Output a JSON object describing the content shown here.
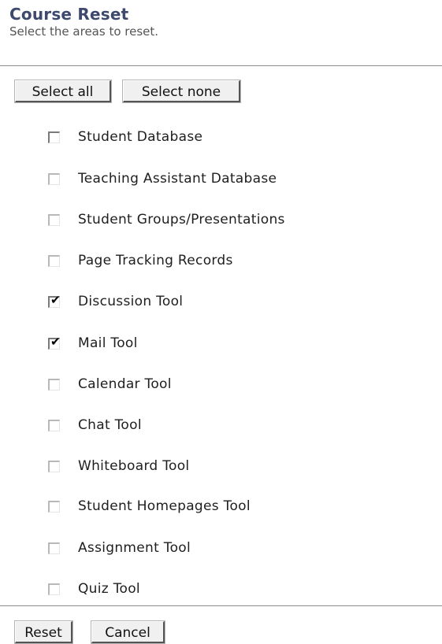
{
  "header": {
    "title": "Course Reset",
    "subtitle": "Select the areas to reset."
  },
  "toolbar": {
    "select_all_label": "Select all",
    "select_none_label": "Select none"
  },
  "options": [
    {
      "label": "Student Database",
      "checked": false
    },
    {
      "label": "Teaching Assistant Database",
      "checked": false
    },
    {
      "label": "Student Groups/Presentations",
      "checked": false
    },
    {
      "label": "Page Tracking Records",
      "checked": false
    },
    {
      "label": "Discussion Tool",
      "checked": true
    },
    {
      "label": "Mail Tool",
      "checked": true
    },
    {
      "label": "Calendar Tool",
      "checked": false
    },
    {
      "label": "Chat Tool",
      "checked": false
    },
    {
      "label": "Whiteboard Tool",
      "checked": false
    },
    {
      "label": "Student Homepages Tool",
      "checked": false
    },
    {
      "label": "Assignment Tool",
      "checked": false
    },
    {
      "label": "Quiz Tool",
      "checked": false
    }
  ],
  "footer": {
    "reset_label": "Reset",
    "cancel_label": "Cancel"
  }
}
